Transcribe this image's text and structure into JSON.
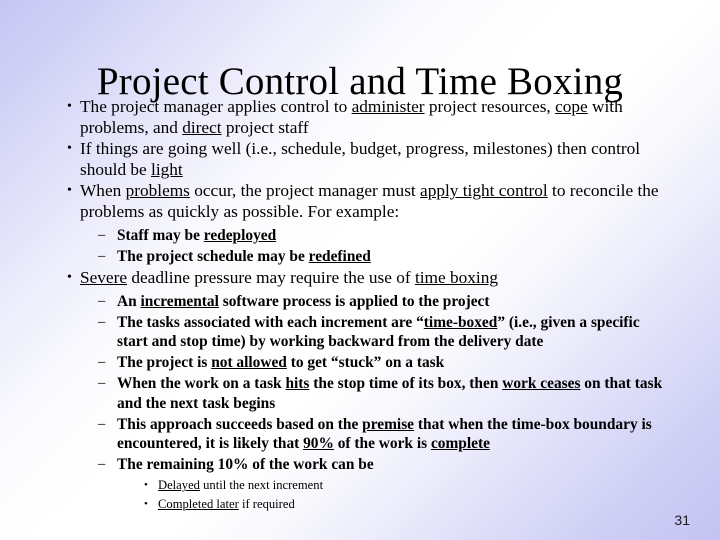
{
  "slide": {
    "title": "Project Control and Time Boxing",
    "page_number": "31",
    "background": {
      "accent_color": "#c6c6f4",
      "base_color": "#ffffff"
    },
    "markers": {
      "level1": "•",
      "level2": "–",
      "level3": "•"
    },
    "bullets": {
      "b1": {
        "p1": "The project manager applies control to ",
        "u1": "administer",
        "p2": " project resources, ",
        "u2": "cope",
        "p3": " with problems, and ",
        "u3": "direct",
        "p4": " project staff"
      },
      "b2": {
        "p1": "If things are going well (i.e., schedule, budget, progress, milestones) then control should be ",
        "u1": "light"
      },
      "b3": {
        "p1": "When ",
        "u1": "problems",
        "p2": " occur, the project manager must ",
        "u2": "apply tight control",
        "p3": " to reconcile the problems as quickly as possible.  For example:"
      },
      "b3s1": {
        "p1": "Staff may be ",
        "u1": "redeployed"
      },
      "b3s2": {
        "p1": "The project schedule may be ",
        "u1": "redefined"
      },
      "b4": {
        "u1": "Severe",
        "p1": " deadline pressure may require the use of ",
        "u2": "time boxing"
      },
      "b4s1": {
        "p1": "An ",
        "u1": "incremental",
        "p2": " software process is applied to the project"
      },
      "b4s2": {
        "p1": "The tasks associated with each increment are “",
        "u1": "time-boxed",
        "p2": "” (i.e., given a specific start and stop time) by working backward from the delivery date"
      },
      "b4s3": {
        "p1": "The project is ",
        "u1": "not allowed",
        "p2": " to get “stuck” on a task"
      },
      "b4s4": {
        "p1": "When the work on a task ",
        "u1": "hits",
        "p2": " the stop time of its box, then ",
        "u2": "work ceases",
        "p3": " on that task and the next task begins"
      },
      "b4s5": {
        "p1": "This approach succeeds based on the ",
        "u1": "premise",
        "p2": " that when the time-box boundary is encountered, it is likely that ",
        "u2": "90%",
        "p3": " of the work is ",
        "u3": "complete"
      },
      "b4s6": {
        "p1": "The remaining 10% of the work can be"
      },
      "b4s6a": {
        "u1": "Delayed",
        "p1": " until the next increment"
      },
      "b4s6b": {
        "u1": "Completed later",
        "p1": " if required"
      }
    }
  }
}
